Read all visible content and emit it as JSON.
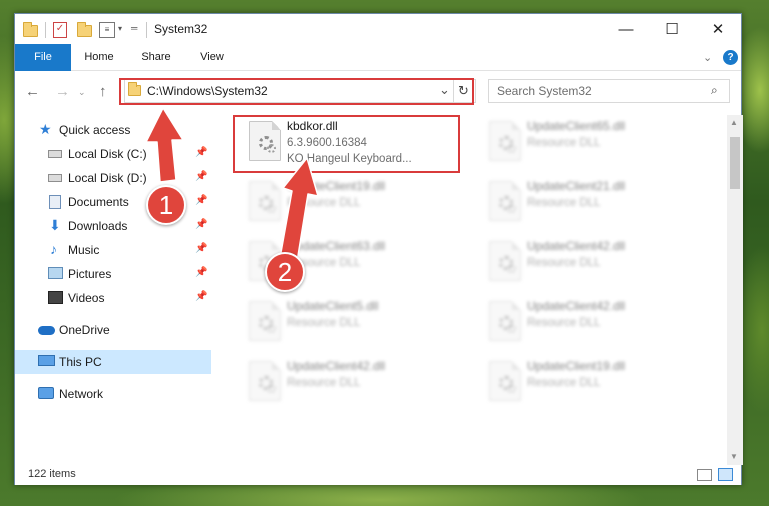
{
  "window": {
    "title": "System32",
    "controls": {
      "minimize": "—",
      "maximize": "☐",
      "close": "✕"
    }
  },
  "ribbon": {
    "tabs": [
      "File",
      "Home",
      "Share",
      "View"
    ],
    "expand_icon": "chevron-down-icon",
    "help_icon": "help-icon"
  },
  "address_bar": {
    "path": "C:\\Windows\\System32"
  },
  "search": {
    "placeholder": "Search System32"
  },
  "sidebar": {
    "items": [
      {
        "label": "Quick access",
        "icon": "star-icon",
        "pinned": false
      },
      {
        "label": "Local Disk (C:)",
        "icon": "drive-icon",
        "pinned": true
      },
      {
        "label": "Local Disk (D:)",
        "icon": "drive-icon",
        "pinned": true
      },
      {
        "label": "Documents",
        "icon": "documents-icon",
        "pinned": true
      },
      {
        "label": "Downloads",
        "icon": "downloads-icon",
        "pinned": true
      },
      {
        "label": "Music",
        "icon": "music-icon",
        "pinned": true
      },
      {
        "label": "Pictures",
        "icon": "pictures-icon",
        "pinned": true
      },
      {
        "label": "Videos",
        "icon": "videos-icon",
        "pinned": true
      },
      {
        "label": "OneDrive",
        "icon": "cloud-icon",
        "pinned": false
      },
      {
        "label": "This PC",
        "icon": "computer-icon",
        "pinned": false,
        "selected": true
      },
      {
        "label": "Network",
        "icon": "network-icon",
        "pinned": false
      }
    ]
  },
  "files": [
    {
      "name": "kbdkor.dll",
      "version": "6.3.9600.16384",
      "description": "KO Hangeul Keyboard...",
      "highlighted": true
    },
    {
      "name": "UpdateClient65.dll",
      "description": "Resource DLL"
    },
    {
      "name": "UpdateClient19.dll",
      "description": "Resource DLL"
    },
    {
      "name": "UpdateClient21.dll",
      "description": "Resource DLL"
    },
    {
      "name": "UpdateClient63.dll",
      "description": "Resource DLL"
    },
    {
      "name": "UpdateClient42.dll",
      "description": "Resource DLL"
    },
    {
      "name": "UpdateClient5.dll",
      "description": "Resource DLL"
    },
    {
      "name": "UpdateClient42.dll",
      "description": "Resource DLL"
    },
    {
      "name": "UpdateClient42.dll",
      "description": "Resource DLL"
    },
    {
      "name": "UpdateClient19.dll",
      "description": "Resource DLL"
    }
  ],
  "status": {
    "item_count": "122 items"
  },
  "annotations": {
    "step1": "1",
    "step2": "2",
    "highlight_color": "#d93b3b"
  }
}
